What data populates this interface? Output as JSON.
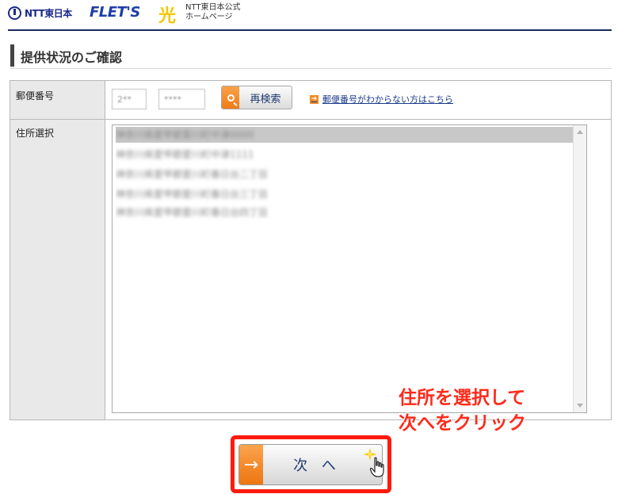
{
  "header": {
    "ntt_logo_text": "NTT東日本",
    "flets_logo_text": "FLET'S",
    "flets_mark": "光",
    "corp_line1": "NTT東日本公式",
    "corp_line2": "ホームページ"
  },
  "page": {
    "title": "提供状況のご確認"
  },
  "form": {
    "postal_label": "郵便番号",
    "postal_part1": "2**",
    "postal_part2": "****",
    "search_button": "再検索",
    "help_link": "郵便番号がわからない方はこちら",
    "address_label": "住所選択",
    "addresses": [
      "神奈川県愛甲郡愛川町中津0000",
      "神奈川県愛甲郡愛川町中津1111",
      "神奈川県愛甲郡愛川町春日台二丁目",
      "神奈川県愛甲郡愛川町春日台三丁目",
      "神奈川県愛甲郡愛川町春日台四丁目"
    ]
  },
  "annotation": {
    "line1": "住所を選択して",
    "line2": "次へをクリック"
  },
  "next_button": {
    "label": "次 へ",
    "arrow": "→"
  },
  "colors": {
    "accent_orange": "#ef7b16",
    "annotation_red": "#ff1a0d",
    "header_navy": "#1a2760"
  }
}
